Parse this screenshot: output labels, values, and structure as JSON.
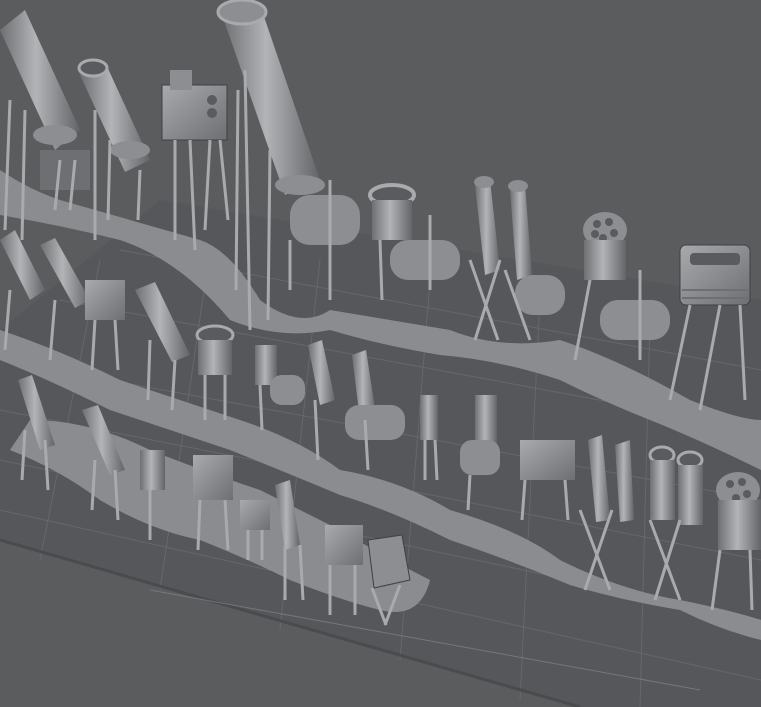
{
  "scene": {
    "colors": {
      "background": "#5b5c5e",
      "plate": "#56575a",
      "grid": "#707276",
      "raft": "#8b8c8f",
      "model_light": "#a9aaad",
      "model_mid": "#8d8e91",
      "model_dark": "#6e6f72",
      "edge": "#3f4043"
    },
    "objects": [
      {
        "kind": "cannon",
        "row": 1,
        "col": 1
      },
      {
        "kind": "cannon",
        "row": 1,
        "col": 2
      },
      {
        "kind": "engine-block",
        "row": 1,
        "col": 3
      },
      {
        "kind": "cannon",
        "row": 1,
        "col": 4
      },
      {
        "kind": "mortar",
        "row": 1,
        "col": 5
      },
      {
        "kind": "twin-tubes",
        "row": 1,
        "col": 6
      },
      {
        "kind": "gatling",
        "row": 1,
        "col": 7
      },
      {
        "kind": "engine-block",
        "row": 1,
        "col": 8
      },
      {
        "kind": "cannon",
        "row": 2,
        "col": 1
      },
      {
        "kind": "cannon",
        "row": 2,
        "col": 2
      },
      {
        "kind": "engine-block",
        "row": 2,
        "col": 3
      },
      {
        "kind": "mortar",
        "row": 2,
        "col": 4
      },
      {
        "kind": "twin-tubes",
        "row": 2,
        "col": 5
      },
      {
        "kind": "small-gun",
        "row": 2,
        "col": 6
      },
      {
        "kind": "small-gun",
        "row": 2,
        "col": 7
      },
      {
        "kind": "twin-tubes",
        "row": 2,
        "col": 8
      },
      {
        "kind": "twin-tubes",
        "row": 2,
        "col": 9
      },
      {
        "kind": "gatling",
        "row": 2,
        "col": 10
      },
      {
        "kind": "small-gun",
        "row": 3,
        "col": 1
      },
      {
        "kind": "small-gun",
        "row": 3,
        "col": 2
      },
      {
        "kind": "engine-block",
        "row": 3,
        "col": 3
      },
      {
        "kind": "small-gun",
        "row": 3,
        "col": 4
      },
      {
        "kind": "twin-tubes",
        "row": 3,
        "col": 5
      },
      {
        "kind": "engine-block",
        "row": 3,
        "col": 6
      }
    ]
  }
}
